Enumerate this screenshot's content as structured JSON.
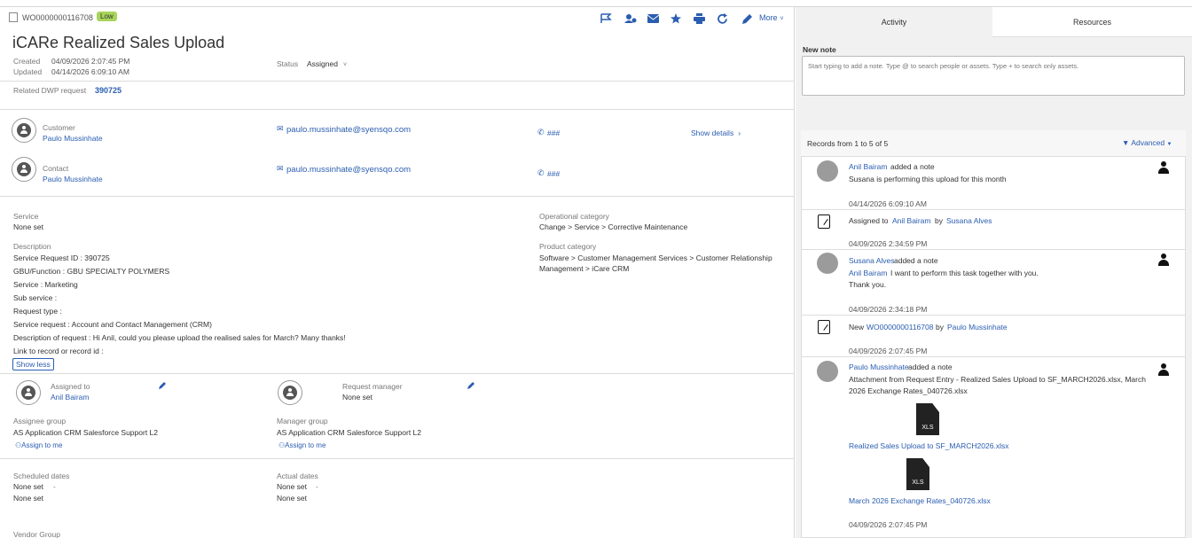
{
  "header": {
    "ticket_id": "WO0000000116708",
    "priority_badge": "Low",
    "more_label": "More",
    "title": "iCARe Realized Sales Upload",
    "created_label": "Created",
    "created_value": "04/09/2026 2:07:45 PM",
    "updated_label": "Updated",
    "updated_value": "04/14/2026 6:09:10 AM",
    "status_label": "Status",
    "status_value": "Assigned",
    "related_label": "Related DWP request",
    "related_value": "390725"
  },
  "toolbar_icons": [
    "flag-icon",
    "assign-icon",
    "mail-icon",
    "star-icon",
    "print-icon",
    "refresh-icon",
    "edit-icon"
  ],
  "customer": {
    "label": "Customer",
    "name": "Paulo Mussinhate",
    "email": "paulo.mussinhate@syensqo.com",
    "phone": "###",
    "show_details": "Show details"
  },
  "contact": {
    "label": "Contact",
    "name": "Paulo Mussinhate",
    "email": "paulo.mussinhate@syensqo.com",
    "phone": "###"
  },
  "details": {
    "service_label": "Service",
    "service_value": "None set",
    "op_cat_label": "Operational category",
    "op_cat_value": "Change > Service > Corrective Maintenance",
    "prod_cat_label": "Product category",
    "prod_cat_value_1": "Software > Customer Management Services > Customer Relationship",
    "prod_cat_value_2": "Management > iCare CRM",
    "description_label": "Description",
    "description_lines": [
      "Service Request ID : 390725",
      "GBU/Function : GBU SPECIALTY POLYMERS",
      "Service : Marketing",
      "Sub service :",
      "Request type :",
      "Service request : Account and Contact Management (CRM)",
      "Description of request : Hi Anil, could you please upload the realised sales for March? Many thanks!",
      "Link to record or record id :"
    ],
    "show_less": "Show less"
  },
  "assignment": {
    "assigned_label": "Assigned to",
    "assigned_value": "Anil Bairam",
    "manager_label": "Request manager",
    "manager_value": "None set",
    "assignee_group_label": "Assignee group",
    "assignee_group_value": "AS Application CRM Salesforce Support L2",
    "manager_group_label": "Manager group",
    "manager_group_value": "AS Application CRM Salesforce Support L2",
    "assign_to_me": "Assign to me"
  },
  "dates": {
    "scheduled_label": "Scheduled dates",
    "scheduled_1": "None set",
    "scheduled_dash": "-",
    "scheduled_2": "None set",
    "actual_label": "Actual dates",
    "actual_1": "None set",
    "actual_dash": "-",
    "actual_2": "None set",
    "vendor_group_label": "Vendor Group"
  },
  "right_panel": {
    "tabs": [
      "Activity",
      "Resources"
    ],
    "new_note_label": "New note",
    "note_placeholder": "Start typing to add a note. Type @ to search people or assets. Type + to search only assets.",
    "records_label": "Records from 1 to 5 of 5",
    "advanced_label": "Advanced",
    "entries": [
      {
        "who": "Anil Bairam",
        "action": "added a note",
        "text": "Susana is performing this upload for this month",
        "time": "04/14/2026 6:09:10 AM"
      },
      {
        "pre": "Assigned to",
        "who": "Anil Bairam",
        "mid": "by",
        "by": "Susana Alves",
        "time": "04/09/2026 2:34:59 PM"
      },
      {
        "who": "Susana Alves",
        "action": "added a note",
        "mention": "Anil Bairam",
        "text": "I want to perform this task together with you.",
        "text2": "Thank you.",
        "time": "04/09/2026 2:34:18 PM"
      },
      {
        "pre": "New",
        "who": "WO0000000116708",
        "mid": "by",
        "by": "Paulo Mussinhate",
        "time": "04/09/2026 2:07:45 PM"
      },
      {
        "who": "Paulo Mussinhate",
        "action": "added a note",
        "text": "Attachment from Request Entry - Realized Sales Upload to SF_MARCH2026.xlsx, March",
        "text2": "2026 Exchange Rates_040726.xlsx",
        "file1": "Realized Sales Upload to SF_MARCH2026.xlsx",
        "file2": "March 2026 Exchange Rates_040726.xlsx",
        "file_type": "XLS",
        "time": "04/09/2026 2:07:45 PM"
      }
    ]
  }
}
